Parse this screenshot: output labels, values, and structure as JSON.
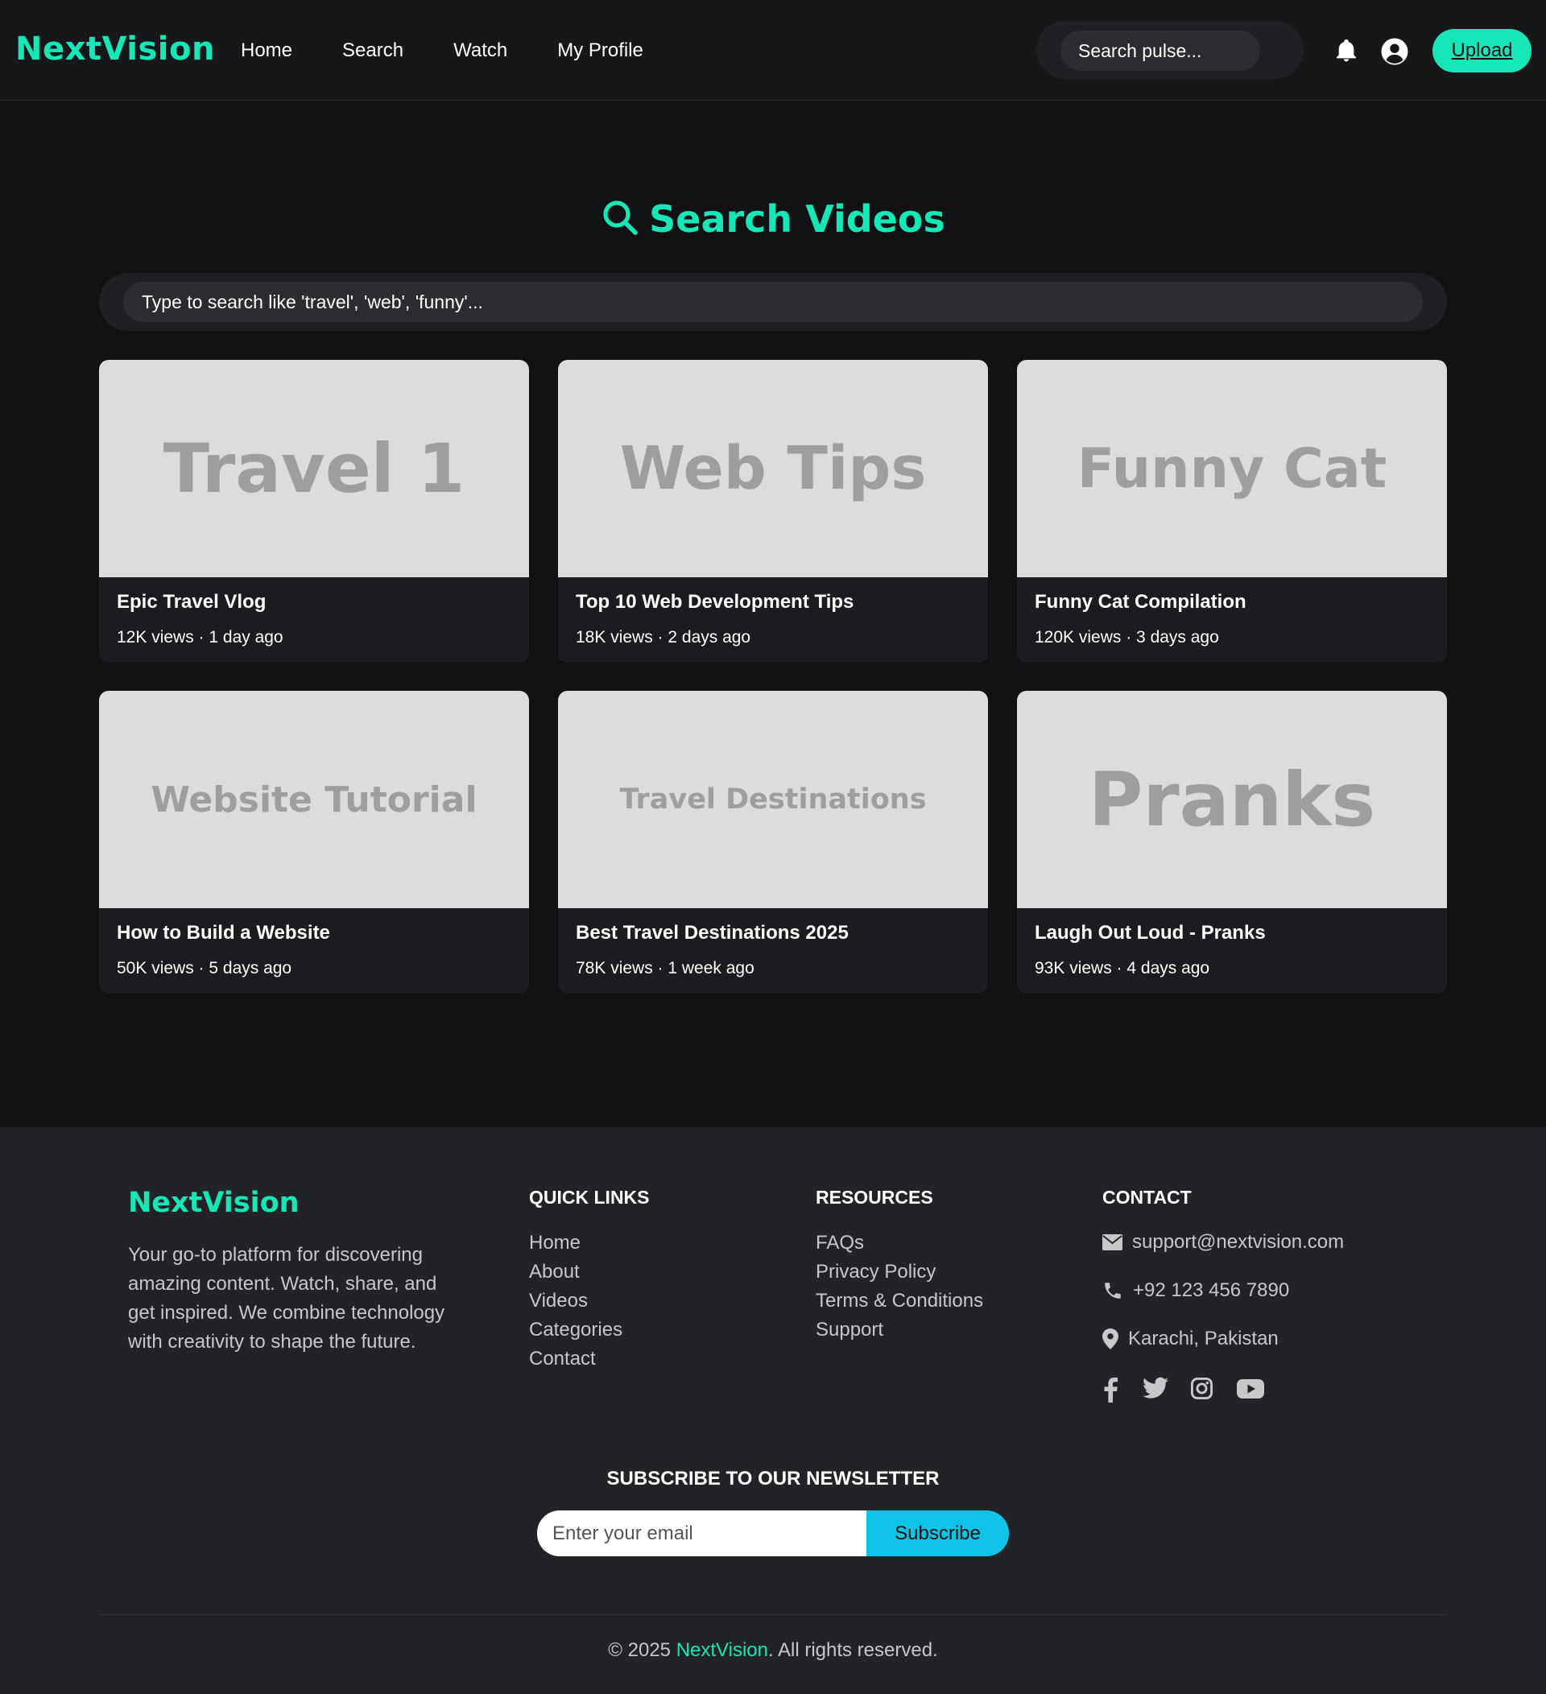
{
  "header": {
    "logo": "NextVision",
    "nav": [
      "Home",
      "Search",
      "Watch",
      "My Profile"
    ],
    "search_placeholder": "Search pulse...",
    "upload_label": "Upload"
  },
  "main": {
    "title": "Search Videos",
    "search_placeholder": "Type to search like 'travel', 'web', 'funny'...",
    "videos": [
      {
        "thumb": "Travel 1",
        "title": "Epic Travel Vlog",
        "meta": "12K views · 1 day ago"
      },
      {
        "thumb": "Web Tips",
        "title": "Top 10 Web Development Tips",
        "meta": "18K views · 2 days ago"
      },
      {
        "thumb": "Funny Cat",
        "title": "Funny Cat Compilation",
        "meta": "120K views · 3 days ago"
      },
      {
        "thumb": "Website Tutorial",
        "title": "How to Build a Website",
        "meta": "50K views · 5 days ago"
      },
      {
        "thumb": "Travel Destinations",
        "title": "Best Travel Destinations 2025",
        "meta": "78K views · 1 week ago"
      },
      {
        "thumb": "Pranks",
        "title": "Laugh Out Loud - Pranks",
        "meta": "93K views · 4 days ago"
      }
    ]
  },
  "footer": {
    "logo": "NextVision",
    "description": "Your go-to platform for discovering amazing content. Watch, share, and get inspired. We combine technology with creativity to shape the future.",
    "quick_links": {
      "title": "QUICK LINKS",
      "items": [
        "Home",
        "About",
        "Videos",
        "Categories",
        "Contact"
      ]
    },
    "resources": {
      "title": "RESOURCES",
      "items": [
        "FAQs",
        "Privacy Policy",
        "Terms & Conditions",
        "Support"
      ]
    },
    "contact": {
      "title": "CONTACT",
      "email": "support@nextvision.com",
      "phone": "+92 123 456 7890",
      "location": "Karachi, Pakistan"
    },
    "social_icons": [
      "facebook-icon",
      "twitter-icon",
      "instagram-icon",
      "youtube-icon"
    ],
    "newsletter": {
      "title": "SUBSCRIBE TO OUR NEWSLETTER",
      "placeholder": "Enter your email",
      "button": "Subscribe"
    },
    "copyright_prefix": "© 2025 ",
    "copyright_brand": "NextVision",
    "copyright_suffix": ". All rights reserved."
  },
  "colors": {
    "accent": "#17e6b8",
    "subscribe": "#0fc3e6",
    "background": "#111214",
    "footer": "#212327"
  }
}
